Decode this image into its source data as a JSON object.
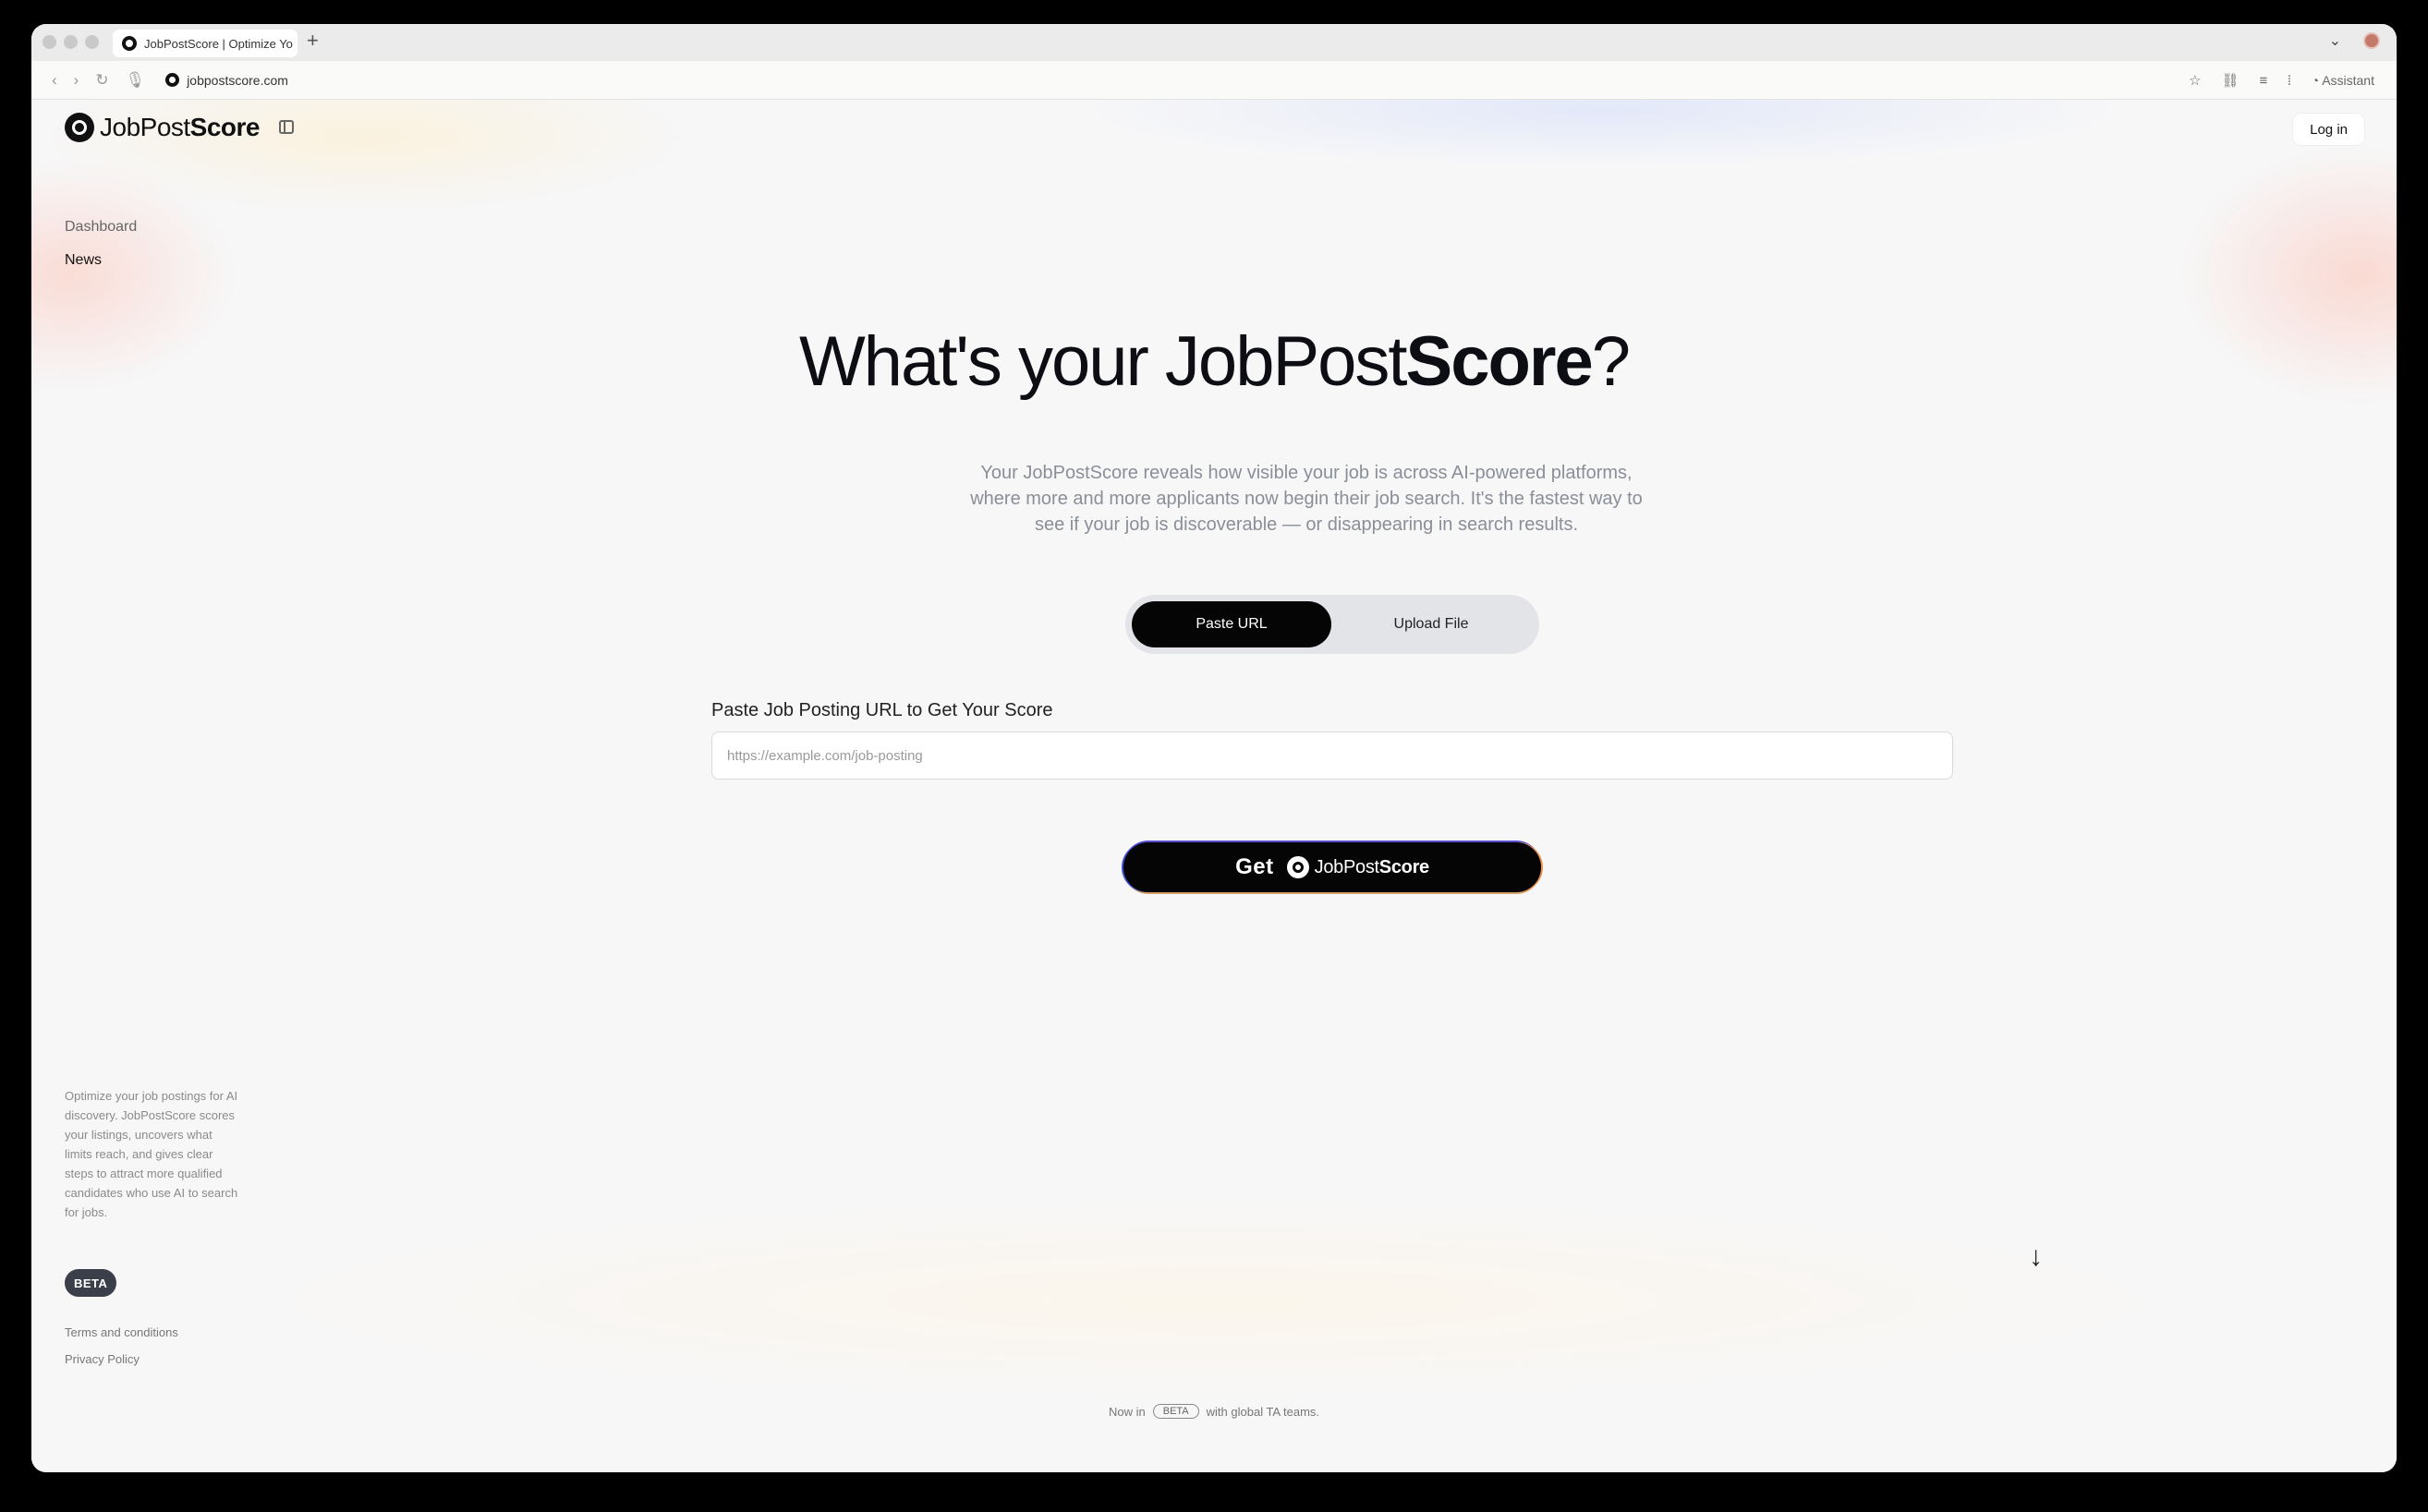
{
  "browser": {
    "tab_title": "JobPostScore | Optimize Yo",
    "new_tab": "+",
    "url": "jobpostscore.com",
    "assistant_label": "Assistant"
  },
  "header": {
    "logo_regular": "JobPost",
    "logo_bold": "Score",
    "login_label": "Log in"
  },
  "sidebar": {
    "items": [
      {
        "label": "Dashboard"
      },
      {
        "label": "News"
      }
    ],
    "description": "Optimize your job postings for AI discovery. JobPostScore scores your listings, uncovers what limits reach, and gives clear steps to attract more qualified candidates who use AI to search for jobs.",
    "badge": "BETA",
    "links": [
      {
        "label": "Terms and conditions"
      },
      {
        "label": "Privacy Policy"
      }
    ]
  },
  "hero": {
    "title_prefix": "What's your JobPost",
    "title_bold": "Score",
    "title_suffix": "?",
    "subtitle": "Your JobPostScore reveals how visible your job is across AI-powered platforms, where more and more applicants now begin their job search. It's the fastest way to see if your job is discoverable — or disappearing in search results."
  },
  "mode_toggle": {
    "options": [
      {
        "label": "Paste URL",
        "active": true
      },
      {
        "label": "Upload File",
        "active": false
      }
    ]
  },
  "form": {
    "label": "Paste Job Posting URL to Get Your Score",
    "placeholder": "https://example.com/job-posting",
    "value": ""
  },
  "cta": {
    "get": "Get",
    "brand_regular": "JobPost",
    "brand_bold": "Score"
  },
  "footer": {
    "prefix": "Now in",
    "badge": "BETA",
    "suffix": "with global TA teams."
  },
  "icons": {
    "scroll_down": "arrow-down-icon"
  }
}
